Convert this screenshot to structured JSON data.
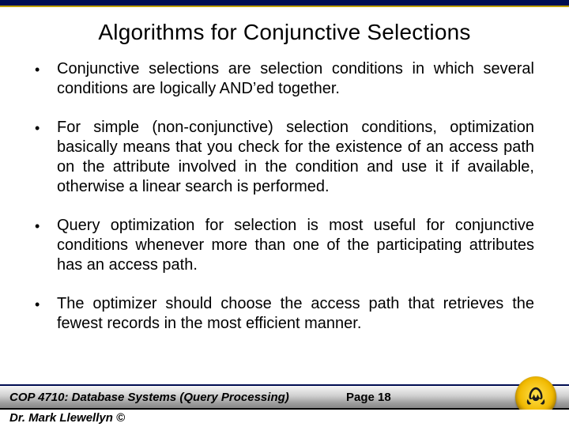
{
  "title": "Algorithms for Conjunctive Selections",
  "bullets": [
    "Conjunctive selections are selection conditions in which several conditions are logically AND’ed together.",
    "For simple (non-conjunctive) selection conditions, optimization basically means that  you check for the existence of an access path on the attribute involved in the condition and use it if available, otherwise a linear search is performed.",
    "Query optimization for selection is most useful for conjunctive conditions whenever more than one of the participating attributes has an access path.",
    "The optimizer should choose the access path that retrieves the fewest records in the most efficient manner."
  ],
  "footer": {
    "course": "COP 4710: Database Systems (Query Processing)",
    "page": "Page 18",
    "author_line": "Dr. Mark Llewellyn ©"
  }
}
